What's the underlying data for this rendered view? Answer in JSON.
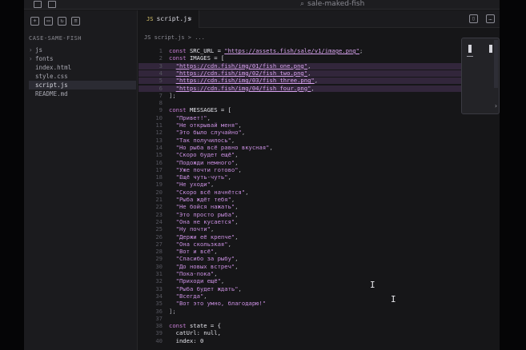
{
  "titlebar": {
    "search_text": "sale-maked-fish",
    "icons": [
      "sidebar-toggle-icon",
      "panel-icon"
    ]
  },
  "sidebar": {
    "title": "CASE-SAME-FISH",
    "toolbar_icons": [
      "new-file-icon",
      "new-folder-icon",
      "refresh-icon",
      "collapse-icon"
    ],
    "tree": [
      {
        "label": "js",
        "chevron": "›",
        "selected": false
      },
      {
        "label": "fonts",
        "chevron": "›",
        "selected": false
      },
      {
        "label": "index.html",
        "chevron": "",
        "selected": false
      },
      {
        "label": "style.css",
        "chevron": "",
        "selected": false
      },
      {
        "label": "script.js",
        "chevron": "",
        "selected": true
      },
      {
        "label": "README.md",
        "chevron": "",
        "selected": false
      }
    ]
  },
  "tabs": [
    {
      "lang": "JS",
      "label": "script.js",
      "close": "×"
    }
  ],
  "breadcrumb": "JS script.js > ...",
  "code": {
    "lines": [
      {
        "n": "1",
        "parts": [
          [
            "kw",
            "const "
          ],
          [
            "id",
            "SRC_URL = "
          ],
          [
            "url",
            "\"https://assets.fish/sale/v1/image.png\""
          ],
          [
            "punc",
            ";"
          ]
        ]
      },
      {
        "n": "2",
        "parts": [
          [
            "kw",
            "const "
          ],
          [
            "id",
            "IMAGES = ["
          ]
        ]
      },
      {
        "n": "3",
        "parts": [
          [
            "punc",
            "  "
          ],
          [
            "url",
            "\"https://cdn.fish/img/01/fish_one.png\""
          ],
          [
            "punc",
            ","
          ]
        ]
      },
      {
        "n": "4",
        "parts": [
          [
            "punc",
            "  "
          ],
          [
            "url",
            "\"https://cdn.fish/img/02/fish_two.png\""
          ],
          [
            "punc",
            ","
          ]
        ]
      },
      {
        "n": "5",
        "parts": [
          [
            "punc",
            "  "
          ],
          [
            "url",
            "\"https://cdn.fish/img/03/fish_three.png\""
          ],
          [
            "punc",
            ","
          ]
        ]
      },
      {
        "n": "6",
        "parts": [
          [
            "punc",
            "  "
          ],
          [
            "url",
            "\"https://cdn.fish/img/04/fish_four.png\""
          ],
          [
            "punc",
            ","
          ]
        ]
      },
      {
        "n": "7",
        "parts": [
          [
            "punc",
            "];"
          ]
        ]
      },
      {
        "n": "8",
        "parts": []
      },
      {
        "n": "9",
        "parts": [
          [
            "kw",
            "const "
          ],
          [
            "id",
            "MESSAGES = ["
          ]
        ]
      },
      {
        "n": "10",
        "parts": [
          [
            "str",
            "  \"Привет!\""
          ],
          [
            "punc",
            ","
          ]
        ]
      },
      {
        "n": "11",
        "parts": [
          [
            "str",
            "  \"Не открывай меня\""
          ],
          [
            "punc",
            ","
          ]
        ]
      },
      {
        "n": "12",
        "parts": [
          [
            "str",
            "  \"Это было случайно\""
          ],
          [
            "punc",
            ","
          ]
        ]
      },
      {
        "n": "13",
        "parts": [
          [
            "str",
            "  \"Так получилось\""
          ],
          [
            "punc",
            ","
          ]
        ]
      },
      {
        "n": "14",
        "parts": [
          [
            "str",
            "  \"Но рыба всё равно вкусная\""
          ],
          [
            "punc",
            ","
          ]
        ]
      },
      {
        "n": "15",
        "parts": [
          [
            "str",
            "  \"Скоро будет ещё\""
          ],
          [
            "punc",
            ","
          ]
        ]
      },
      {
        "n": "16",
        "parts": [
          [
            "str",
            "  \"Подожди немного\""
          ],
          [
            "punc",
            ","
          ]
        ]
      },
      {
        "n": "17",
        "parts": [
          [
            "str",
            "  \"Уже почти готово\""
          ],
          [
            "punc",
            ","
          ]
        ]
      },
      {
        "n": "18",
        "parts": [
          [
            "str",
            "  \"Ещё чуть-чуть\""
          ],
          [
            "punc",
            ","
          ]
        ]
      },
      {
        "n": "19",
        "parts": [
          [
            "str",
            "  \"Не уходи\""
          ],
          [
            "punc",
            ","
          ]
        ]
      },
      {
        "n": "20",
        "parts": [
          [
            "str",
            "  \"Скоро всё начнётся\""
          ],
          [
            "punc",
            ","
          ]
        ]
      },
      {
        "n": "21",
        "parts": [
          [
            "str",
            "  \"Рыба ждёт тебя\""
          ],
          [
            "punc",
            ","
          ]
        ]
      },
      {
        "n": "22",
        "parts": [
          [
            "str",
            "  \"Не бойся нажать\""
          ],
          [
            "punc",
            ","
          ]
        ]
      },
      {
        "n": "23",
        "parts": [
          [
            "str",
            "  \"Это просто рыба\""
          ],
          [
            "punc",
            ","
          ]
        ]
      },
      {
        "n": "24",
        "parts": [
          [
            "str",
            "  \"Она не кусается\""
          ],
          [
            "punc",
            ","
          ]
        ]
      },
      {
        "n": "25",
        "parts": [
          [
            "str",
            "  \"Ну почти\""
          ],
          [
            "punc",
            ","
          ]
        ]
      },
      {
        "n": "26",
        "parts": [
          [
            "str",
            "  \"Держи её крепче\""
          ],
          [
            "punc",
            ","
          ]
        ]
      },
      {
        "n": "27",
        "parts": [
          [
            "str",
            "  \"Она скользкая\""
          ],
          [
            "punc",
            ","
          ]
        ]
      },
      {
        "n": "28",
        "parts": [
          [
            "str",
            "  \"Вот и всё\""
          ],
          [
            "punc",
            ","
          ]
        ]
      },
      {
        "n": "29",
        "parts": [
          [
            "str",
            "  \"Спасибо за рыбу\""
          ],
          [
            "punc",
            ","
          ]
        ]
      },
      {
        "n": "30",
        "parts": [
          [
            "str",
            "  \"До новых встреч\""
          ],
          [
            "punc",
            ","
          ]
        ]
      },
      {
        "n": "31",
        "parts": [
          [
            "str",
            "  \"Пока-пока\""
          ],
          [
            "punc",
            ","
          ]
        ]
      },
      {
        "n": "32",
        "parts": [
          [
            "str",
            "  \"Приходи ещё\""
          ],
          [
            "punc",
            ","
          ]
        ]
      },
      {
        "n": "33",
        "parts": [
          [
            "str",
            "  \"Рыба будет ждать\""
          ],
          [
            "punc",
            ","
          ]
        ]
      },
      {
        "n": "34",
        "parts": [
          [
            "str",
            "  \"Всегда\""
          ],
          [
            "punc",
            ","
          ]
        ]
      },
      {
        "n": "35",
        "parts": [
          [
            "str",
            "  \"Вот это умно, благодарю!\""
          ]
        ]
      },
      {
        "n": "36",
        "parts": [
          [
            "punc",
            "];"
          ]
        ]
      },
      {
        "n": "37",
        "parts": []
      },
      {
        "n": "38",
        "parts": [
          [
            "kw",
            "const "
          ],
          [
            "id",
            "state = {"
          ]
        ]
      },
      {
        "n": "39",
        "parts": [
          [
            "id",
            "  catUrl: null,"
          ]
        ]
      },
      {
        "n": "40",
        "parts": [
          [
            "id",
            "  index: 0"
          ]
        ]
      }
    ]
  },
  "find_widget": {
    "arrow": "›"
  },
  "colors": {
    "background": "#161618",
    "keyword": "#c97fd6",
    "string": "#c98fe0",
    "url": "#d6a2ec",
    "line_number": "#55555e"
  }
}
